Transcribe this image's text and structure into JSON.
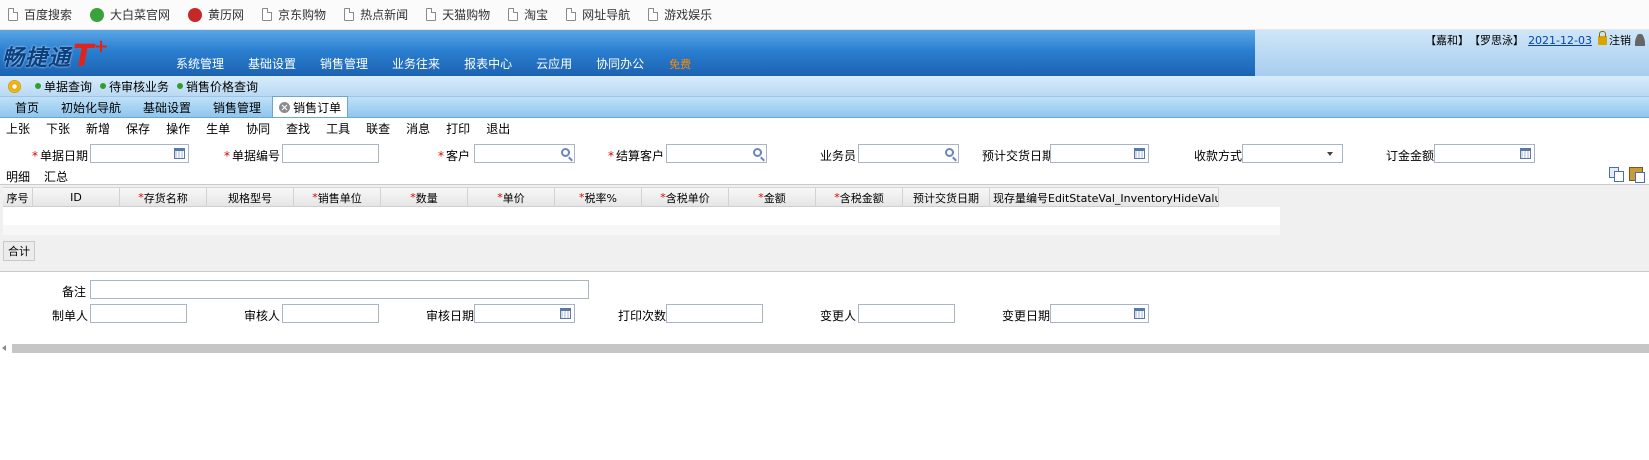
{
  "bookmarks": [
    {
      "label": "百度搜索",
      "icon": "page-icon"
    },
    {
      "label": "大白菜官网",
      "icon": "cabbage-icon"
    },
    {
      "label": "黄历网",
      "icon": "yinyang-icon"
    },
    {
      "label": "京东购物",
      "icon": "page-icon"
    },
    {
      "label": "热点新闻",
      "icon": "page-icon"
    },
    {
      "label": "天猫购物",
      "icon": "page-icon"
    },
    {
      "label": "淘宝",
      "icon": "page-icon"
    },
    {
      "label": "网址导航",
      "icon": "page-icon"
    },
    {
      "label": "游戏娱乐",
      "icon": "page-icon"
    }
  ],
  "header": {
    "logo_text": "畅捷通",
    "logo_t": "T",
    "logo_plus": "+",
    "nav": [
      "系统管理",
      "基础设置",
      "销售管理",
      "业务往来",
      "报表中心",
      "云应用",
      "协同办公"
    ],
    "nav_badge": "免费",
    "account": "【嘉和】",
    "user": "【罗思泳】",
    "date": "2021-12-03",
    "logout": "注销",
    "colors": {
      "nav_bg": "#2b7fd0",
      "badge": "#ff8a00",
      "logo": "#e2231a"
    }
  },
  "quickbar": {
    "items": [
      "单据查询",
      "待审核业务",
      "销售价格查询"
    ]
  },
  "tabs": {
    "items": [
      "首页",
      "初始化导航",
      "基础设置",
      "销售管理"
    ],
    "active": "销售订单"
  },
  "toolbar": {
    "buttons": [
      "上张",
      "下张",
      "新增",
      "保存",
      "操作",
      "生单",
      "协同",
      "查找",
      "工具",
      "联查",
      "消息",
      "打印",
      "退出"
    ]
  },
  "form": {
    "required_mark": "*",
    "fields": {
      "doc_date": {
        "label": "单据日期",
        "value": ""
      },
      "doc_no": {
        "label": "单据编号",
        "value": ""
      },
      "customer": {
        "label": "客户",
        "value": ""
      },
      "settle_customer": {
        "label": "结算客户",
        "value": ""
      },
      "salesman": {
        "label": "业务员",
        "value": ""
      },
      "delivery_date": {
        "label": "预计交货日期",
        "value": ""
      },
      "payment": {
        "label": "收款方式",
        "value": ""
      },
      "order_amount": {
        "label": "订金金额",
        "value": ""
      }
    }
  },
  "detail": {
    "subtabs": [
      "明细",
      "汇总"
    ],
    "columns": [
      {
        "label": "序号",
        "required": false
      },
      {
        "label": "ID",
        "required": false
      },
      {
        "label": "存货名称",
        "required": true
      },
      {
        "label": "规格型号",
        "required": false
      },
      {
        "label": "销售单位",
        "required": true
      },
      {
        "label": "数量",
        "required": true
      },
      {
        "label": "单价",
        "required": true
      },
      {
        "label": "税率%",
        "required": true
      },
      {
        "label": "含税单价",
        "required": true
      },
      {
        "label": "金额",
        "required": true
      },
      {
        "label": "含税金额",
        "required": true
      },
      {
        "label": "预计交货日期",
        "required": false
      },
      {
        "label": "现存量编号EditStateVal_InventoryHideValues",
        "required": false
      }
    ],
    "sum_label": "合计"
  },
  "footer": {
    "remark": {
      "label": "备注",
      "value": ""
    },
    "maker": {
      "label": "制单人",
      "value": ""
    },
    "auditor": {
      "label": "审核人",
      "value": ""
    },
    "audit_date": {
      "label": "审核日期",
      "value": ""
    },
    "print_count": {
      "label": "打印次数",
      "value": ""
    },
    "changer": {
      "label": "变更人",
      "value": ""
    },
    "change_date": {
      "label": "变更日期",
      "value": ""
    }
  }
}
